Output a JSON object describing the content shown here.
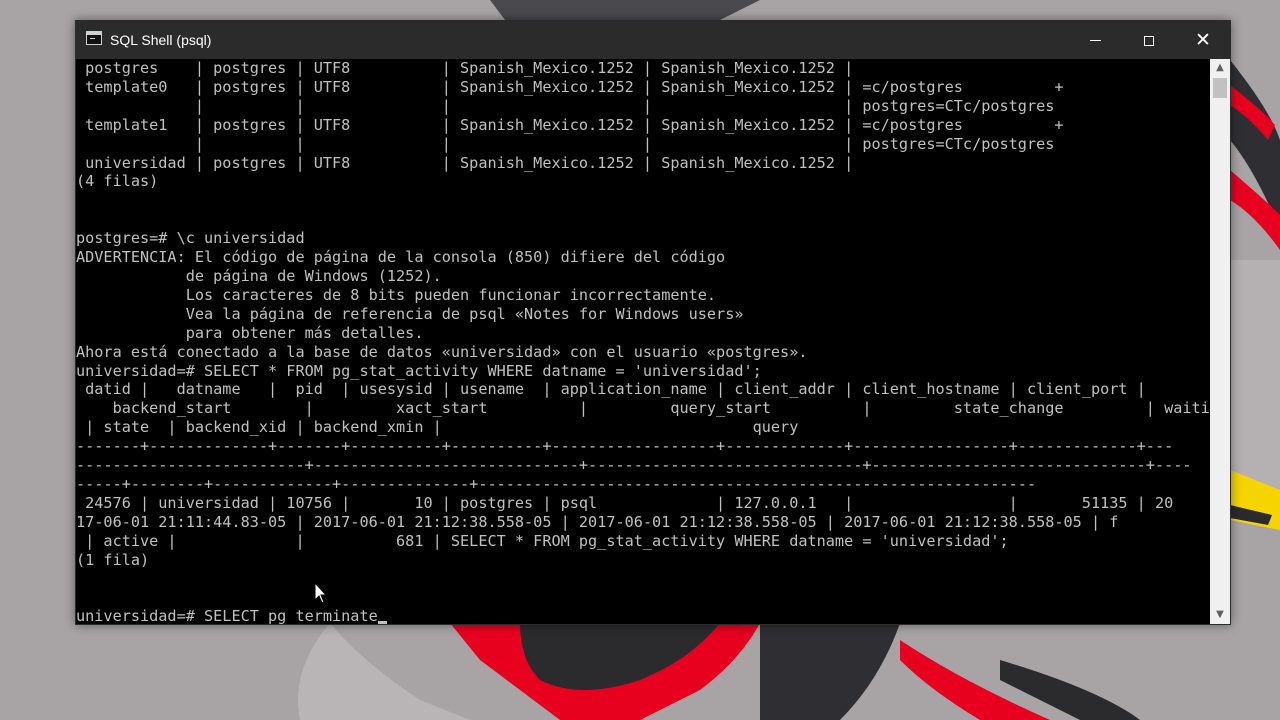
{
  "window": {
    "title": "SQL Shell (psql)",
    "icon": "console-icon",
    "controls": [
      "minimize-icon",
      "maximize-icon",
      "close-icon"
    ],
    "close_glyph": "✕"
  },
  "colors": {
    "desktop": "#a8a4a6",
    "titlebar": "#2b2b2b",
    "console_bg": "#000000",
    "console_text": "#c0c0c0",
    "accent_red": "#e8001f",
    "accent_yellow": "#f5d400"
  },
  "console": {
    "lines": [
      " postgres    | postgres | UTF8          | Spanish_Mexico.1252 | Spanish_Mexico.1252 |",
      " template0   | postgres | UTF8          | Spanish_Mexico.1252 | Spanish_Mexico.1252 | =c/postgres          +",
      "             |          |               |                     |                     | postgres=CTc/postgres",
      " template1   | postgres | UTF8          | Spanish_Mexico.1252 | Spanish_Mexico.1252 | =c/postgres          +",
      "             |          |               |                     |                     | postgres=CTc/postgres",
      " universidad | postgres | UTF8          | Spanish_Mexico.1252 | Spanish_Mexico.1252 |",
      "(4 filas)",
      "",
      "",
      "postgres=# \\c universidad",
      "ADVERTENCIA: El código de página de la consola (850) difiere del código",
      "            de página de Windows (1252).",
      "            Los caracteres de 8 bits pueden funcionar incorrectamente.",
      "            Vea la página de referencia de psql «Notes for Windows users»",
      "            para obtener más detalles.",
      "Ahora está conectado a la base de datos «universidad» con el usuario «postgres».",
      "universidad=# SELECT * FROM pg_stat_activity WHERE datname = 'universidad';",
      " datid |   datname   |  pid  | usesysid | usename  | application_name | client_addr | client_hostname | client_port |",
      "    backend_start        |         xact_start          |         query_start          |         state_change         | waiting",
      " | state  | backend_xid | backend_xmin |                                  query",
      "-------+-------------+-------+----------+----------+------------------+-------------+-----------------+-------------+---",
      "-------------------------+-----------------------------+------------------------------+------------------------------+----",
      "-----+--------+-------------+--------------+-------------------------------------------------------------",
      " 24576 | universidad | 10756 |       10 | postgres | psql             | 127.0.0.1   |                 |       51135 | 20",
      "17-06-01 21:11:44.83-05 | 2017-06-01 21:12:38.558-05 | 2017-06-01 21:12:38.558-05 | 2017-06-01 21:12:38.558-05 | f",
      " | active |             |          681 | SELECT * FROM pg_stat_activity WHERE datname = 'universidad';",
      "(1 fila)",
      "",
      ""
    ],
    "prompt_line": "universidad=# SELECT pg_terminate"
  },
  "scrollbar": {
    "up_arrow": "▲",
    "down_arrow": "▼"
  }
}
